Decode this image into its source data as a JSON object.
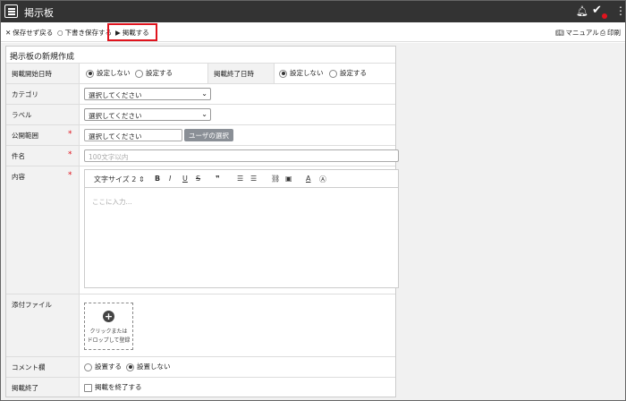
{
  "app": {
    "title": "掲示板"
  },
  "toolbar": {
    "nosave_label": "保存せず戻る",
    "draft_label": "下書き保存する",
    "publish_label": "掲載する",
    "manual_label": "マニュアル",
    "print_label": "印刷"
  },
  "form": {
    "heading": "掲示板の新規作成",
    "start": {
      "label": "掲載開始日時",
      "opt_off": "設定しない",
      "opt_on": "設定する",
      "selected": "設定しない"
    },
    "end": {
      "label": "掲載終了日時",
      "opt_off": "設定しない",
      "opt_on": "設定する",
      "selected": "設定しない"
    },
    "category": {
      "label": "カテゴリ",
      "value": "選択してください"
    },
    "label_field": {
      "label": "ラベル",
      "value": "選択してください"
    },
    "scope": {
      "label": "公開範囲",
      "value": "選択してください",
      "button": "ユーザの選択"
    },
    "subject": {
      "label": "件名",
      "placeholder": "100文字以内"
    },
    "body": {
      "label": "内容",
      "font_size": "文字サイズ 2",
      "placeholder": "ここに入力..."
    },
    "attachment": {
      "label": "添付ファイル",
      "line1": "クリックまたは",
      "line2": "ドロップして登録"
    },
    "comment": {
      "label": "コメント欄",
      "opt_on": "設置する",
      "opt_off": "設置しない",
      "selected": "設置しない"
    },
    "finish": {
      "label": "掲載終了",
      "checkbox": "掲載を終了する",
      "checked": false
    }
  },
  "colors": {
    "titlebar": "#333333",
    "highlight": "#e0141e",
    "required": "#e0141e",
    "user_button": "#8a8f96"
  }
}
